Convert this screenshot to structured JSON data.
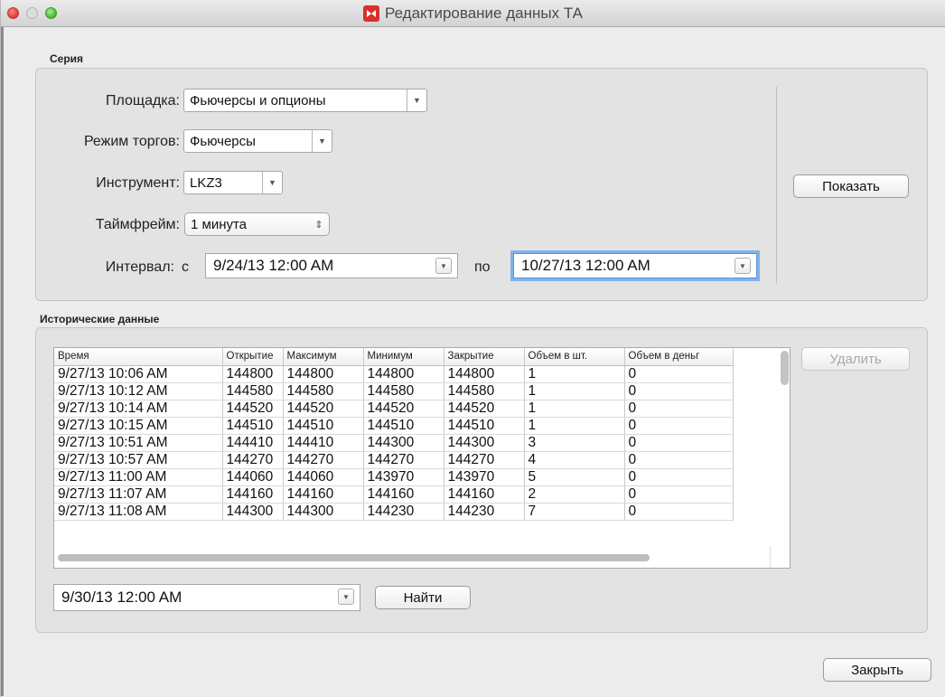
{
  "window": {
    "title": "Редактирование данных ТА"
  },
  "series_group": {
    "label": "Серия",
    "platform_label": "Площадка:",
    "platform_value": "Фьючерсы и опционы",
    "mode_label": "Режим торгов:",
    "mode_value": "Фьючерсы",
    "instrument_label": "Инструмент:",
    "instrument_value": "LKZ3",
    "timeframe_label": "Таймфрейм:",
    "timeframe_value": "1 минута",
    "interval_label": "Интервал:",
    "from_label": "с",
    "from_value": "9/24/13 12:00 AM",
    "to_label": "по",
    "to_value": "10/27/13 12:00 AM",
    "show_button": "Показать"
  },
  "history_group": {
    "label": "Исторические данные",
    "columns": [
      "Время",
      "Открытие",
      "Максимум",
      "Минимум",
      "Закрытие",
      "Объем в шт.",
      "Объем в деньг"
    ],
    "rows": [
      [
        "9/27/13 10:06 AM",
        "144800",
        "144800",
        "144800",
        "144800",
        "1",
        "0"
      ],
      [
        "9/27/13 10:12 AM",
        "144580",
        "144580",
        "144580",
        "144580",
        "1",
        "0"
      ],
      [
        "9/27/13 10:14 AM",
        "144520",
        "144520",
        "144520",
        "144520",
        "1",
        "0"
      ],
      [
        "9/27/13 10:15 AM",
        "144510",
        "144510",
        "144510",
        "144510",
        "1",
        "0"
      ],
      [
        "9/27/13 10:51 AM",
        "144410",
        "144410",
        "144300",
        "144300",
        "3",
        "0"
      ],
      [
        "9/27/13 10:57 AM",
        "144270",
        "144270",
        "144270",
        "144270",
        "4",
        "0"
      ],
      [
        "9/27/13 11:00 AM",
        "144060",
        "144060",
        "143970",
        "143970",
        "5",
        "0"
      ],
      [
        "9/27/13 11:07 AM",
        "144160",
        "144160",
        "144160",
        "144160",
        "2",
        "0"
      ],
      [
        "9/27/13 11:08 AM",
        "144300",
        "144300",
        "144230",
        "144230",
        "7",
        "0"
      ]
    ],
    "delete_button": "Удалить",
    "search_value": "9/30/13 12:00 AM",
    "find_button": "Найти"
  },
  "footer": {
    "close_button": "Закрыть"
  }
}
